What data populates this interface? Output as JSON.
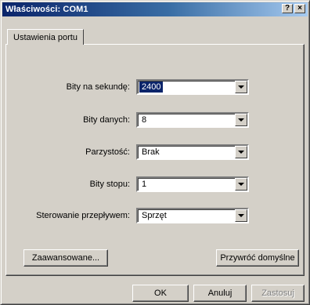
{
  "window": {
    "title": "Właściwości: COM1",
    "help_glyph": "?",
    "close_glyph": "×"
  },
  "tabs": [
    {
      "label": "Ustawienia portu",
      "active": true
    }
  ],
  "fields": [
    {
      "label": "Bity na sekundę:",
      "value": "2400",
      "selected": true
    },
    {
      "label": "Bity danych:",
      "value": "8",
      "selected": false
    },
    {
      "label": "Parzystość:",
      "value": "Brak",
      "selected": false
    },
    {
      "label": "Bity stopu:",
      "value": "1",
      "selected": false
    },
    {
      "label": "Sterowanie przepływem:",
      "value": "Sprzęt",
      "selected": false
    }
  ],
  "buttons": {
    "advanced": "Zaawansowane...",
    "restore_defaults": "Przywróć domyślne",
    "ok": "OK",
    "cancel": "Anuluj",
    "apply": "Zastosuj"
  },
  "colors": {
    "face": "#d4d0c8",
    "title_active": "#0a246a",
    "selection": "#0a246a"
  }
}
